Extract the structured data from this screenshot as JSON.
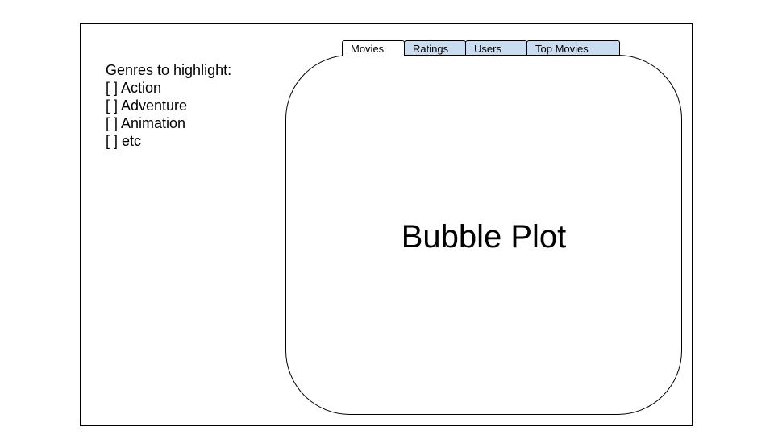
{
  "sidebar": {
    "heading": "Genres to highlight:",
    "options": [
      {
        "label": "[ ] Action"
      },
      {
        "label": "[ ] Adventure"
      },
      {
        "label": "[ ] Animation"
      },
      {
        "label": "[ ] etc"
      }
    ]
  },
  "tabs": [
    {
      "label": "Movies",
      "active": true
    },
    {
      "label": "Ratings",
      "active": false
    },
    {
      "label": "Users",
      "active": false
    },
    {
      "label": "Top Movies",
      "active": false
    }
  ],
  "panel": {
    "label": "Bubble Plot"
  },
  "colors": {
    "inactive_tab": "#c9dcf0",
    "active_tab": "#ffffff",
    "border": "#000000"
  }
}
